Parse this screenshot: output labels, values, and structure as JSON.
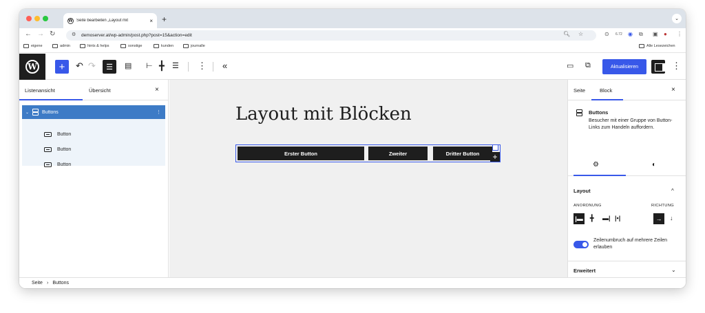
{
  "browser": {
    "tab_title": "Seite bearbeiten „Layout mit",
    "tab_close": "×",
    "new_tab": "+",
    "url": "demoserver.at/wp-admin/post.php?post=15&action=edit",
    "ext_badge": "6.72",
    "bookmarks": [
      "eigene",
      "admin",
      "hints & helps",
      "sonstige",
      "kunden",
      "journalle"
    ],
    "bookmarks_right": "Alle Lesezeichen"
  },
  "editor": {
    "update_label": "Aktualisieren",
    "collapse_icon": "«"
  },
  "left_panel": {
    "tab_list": "Listenansicht",
    "tab_overview": "Übersicht",
    "close": "×",
    "selected_item": "Buttons",
    "children": [
      "Button",
      "Button",
      "Button"
    ]
  },
  "canvas": {
    "title": "Layout mit Blöcken",
    "buttons": [
      "Erster Button",
      "Zweiter",
      "Dritter Button"
    ],
    "append": "+"
  },
  "right_panel": {
    "tab_page": "Seite",
    "tab_block": "Block",
    "close": "×",
    "block_name": "Buttons",
    "block_desc": "Besucher mit einer Gruppe von Button-Links zum Handeln auffordern.",
    "layout_title": "Layout",
    "layout_chevron": "^",
    "justification_label": "ANORDNUNG",
    "orientation_label": "RICHTUNG",
    "wrap_label": "Zeilenumbruch auf mehrere Zeilen erlauben",
    "wrap_enabled": true,
    "advanced_title": "Erweitert"
  },
  "footer": {
    "crumb_root": "Seite",
    "crumb_sep": "›",
    "crumb_current": "Buttons"
  },
  "colors": {
    "accent": "#3858e9",
    "selection": "#3d7bc6",
    "dark": "#1e1e1e"
  }
}
